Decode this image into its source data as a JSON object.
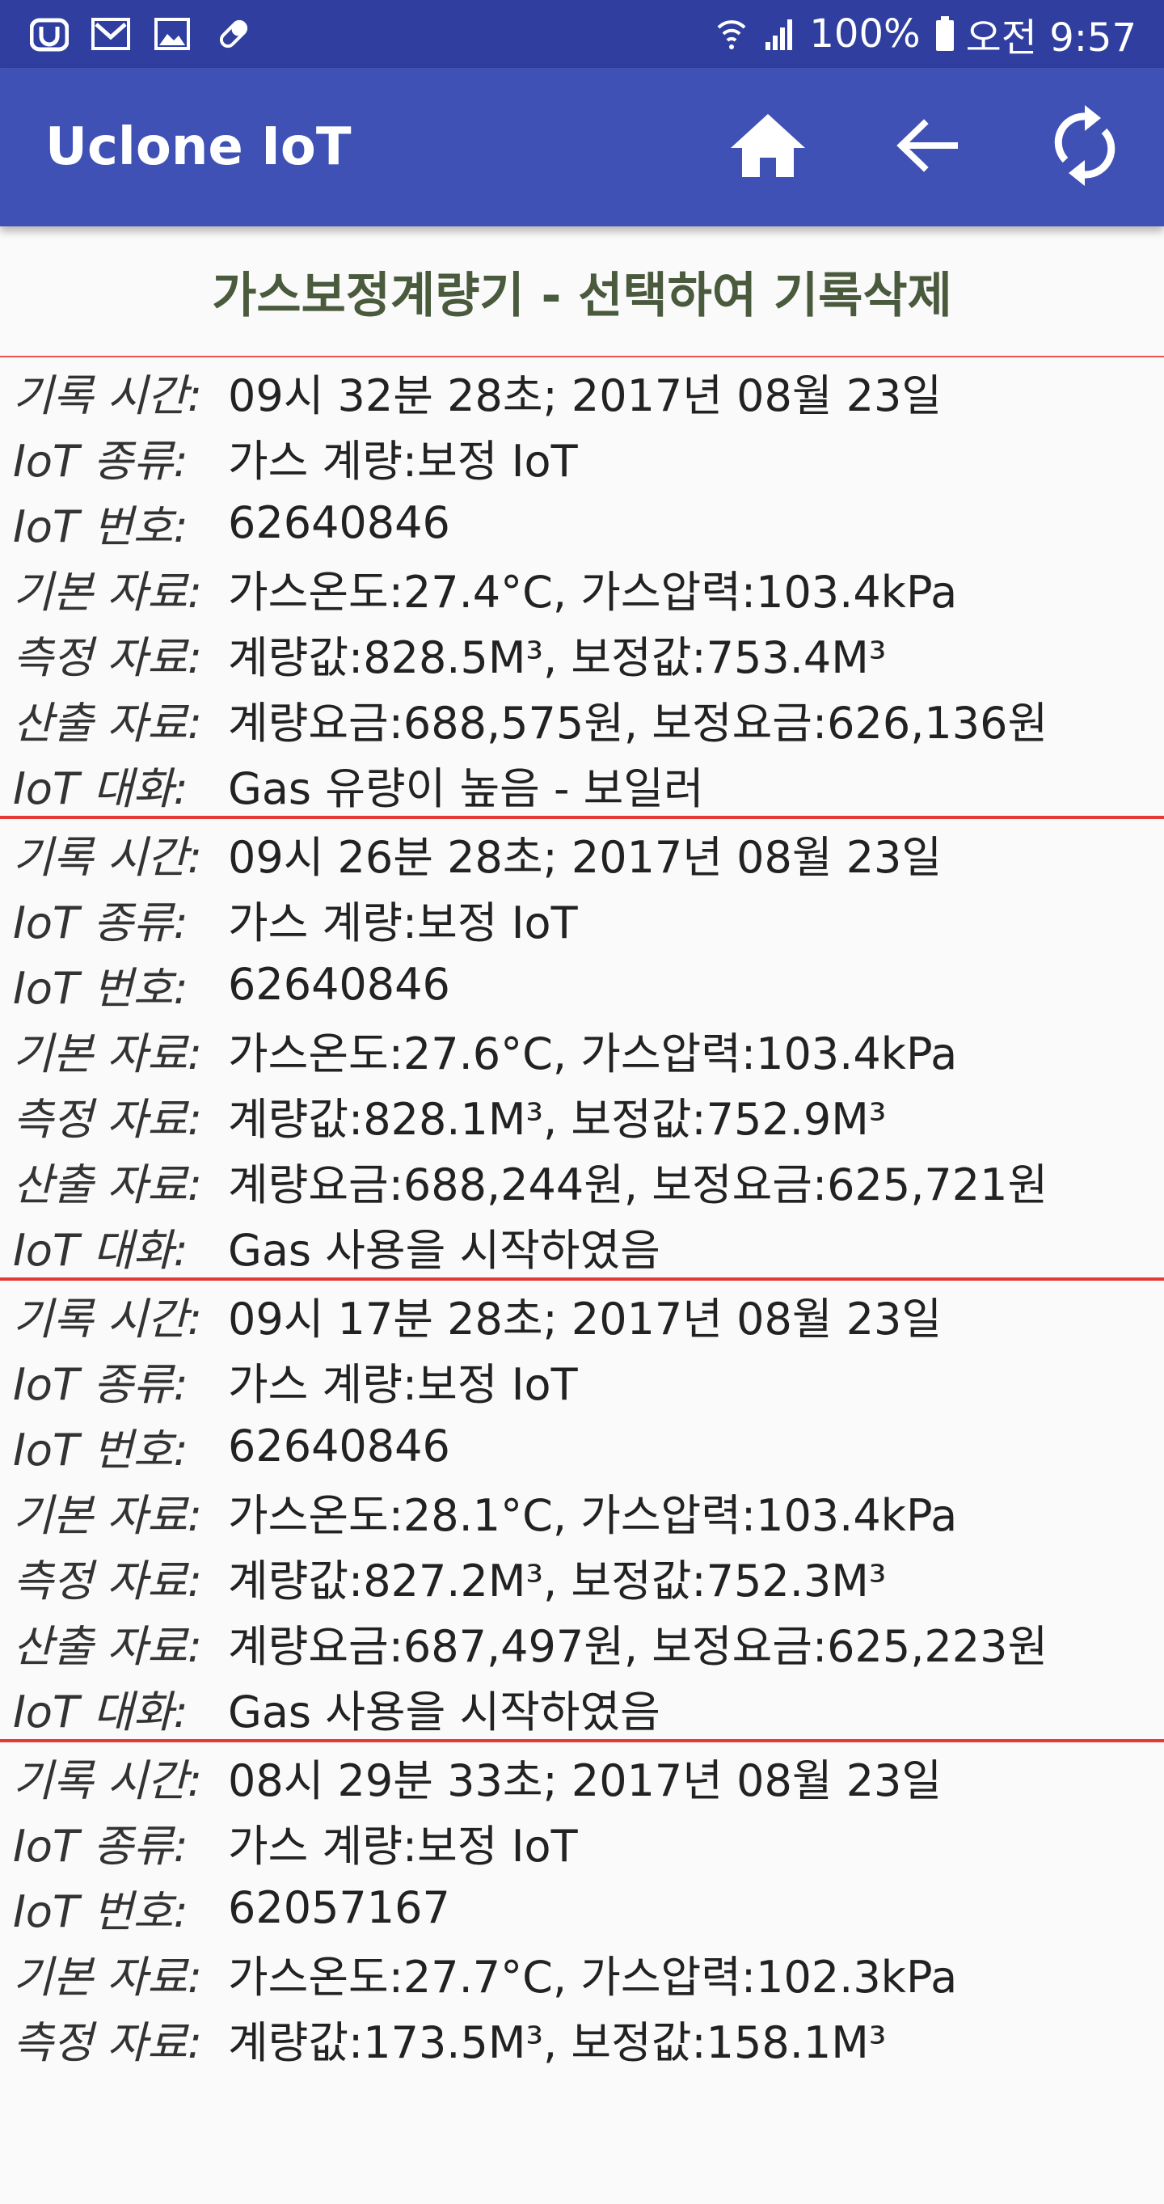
{
  "status_bar": {
    "battery": "100%",
    "time": "오전 9:57",
    "icons": [
      "u-app-icon",
      "gmail-icon",
      "image-icon",
      "pill-icon",
      "wifi-icon",
      "signal-icon",
      "battery-icon"
    ]
  },
  "app_bar": {
    "title": "Uclone IoT",
    "actions": [
      "home-icon",
      "back-arrow-icon",
      "refresh-icon"
    ]
  },
  "page": {
    "header": "가스보정계량기 - 선택하여 기록삭제"
  },
  "labels": {
    "time": "기록 시간:",
    "type": "IoT 종류:",
    "id": "IoT 번호:",
    "basic": "기본 자료:",
    "measure": "측정 자료:",
    "calc": "산출 자료:",
    "talk": "IoT 대화:"
  },
  "records": [
    {
      "time": "09시 32분 28초; 2017년 08월 23일",
      "type": "가스 계량:보정 IoT",
      "id": "62640846",
      "basic": "가스온도:27.4°C, 가스압력:103.4kPa",
      "measure": "계량값:828.5M³, 보정값:753.4M³",
      "calc": "계량요금:688,575원, 보정요금:626,136원",
      "talk": "Gas 유량이 높음 - 보일러"
    },
    {
      "time": "09시 26분 28초; 2017년 08월 23일",
      "type": "가스 계량:보정 IoT",
      "id": "62640846",
      "basic": "가스온도:27.6°C, 가스압력:103.4kPa",
      "measure": "계량값:828.1M³, 보정값:752.9M³",
      "calc": "계량요금:688,244원, 보정요금:625,721원",
      "talk": "Gas 사용을 시작하였음"
    },
    {
      "time": "09시 17분 28초; 2017년 08월 23일",
      "type": "가스 계량:보정 IoT",
      "id": "62640846",
      "basic": "가스온도:28.1°C, 가스압력:103.4kPa",
      "measure": "계량값:827.2M³, 보정값:752.3M³",
      "calc": "계량요금:687,497원, 보정요금:625,223원",
      "talk": "Gas 사용을 시작하였음"
    },
    {
      "time": "08시 29분 33초; 2017년 08월 23일",
      "type": "가스 계량:보정 IoT",
      "id": "62057167",
      "basic": "가스온도:27.7°C, 가스압력:102.3kPa",
      "measure": "계량값:173.5M³, 보정값:158.1M³",
      "calc": "",
      "talk": ""
    }
  ]
}
